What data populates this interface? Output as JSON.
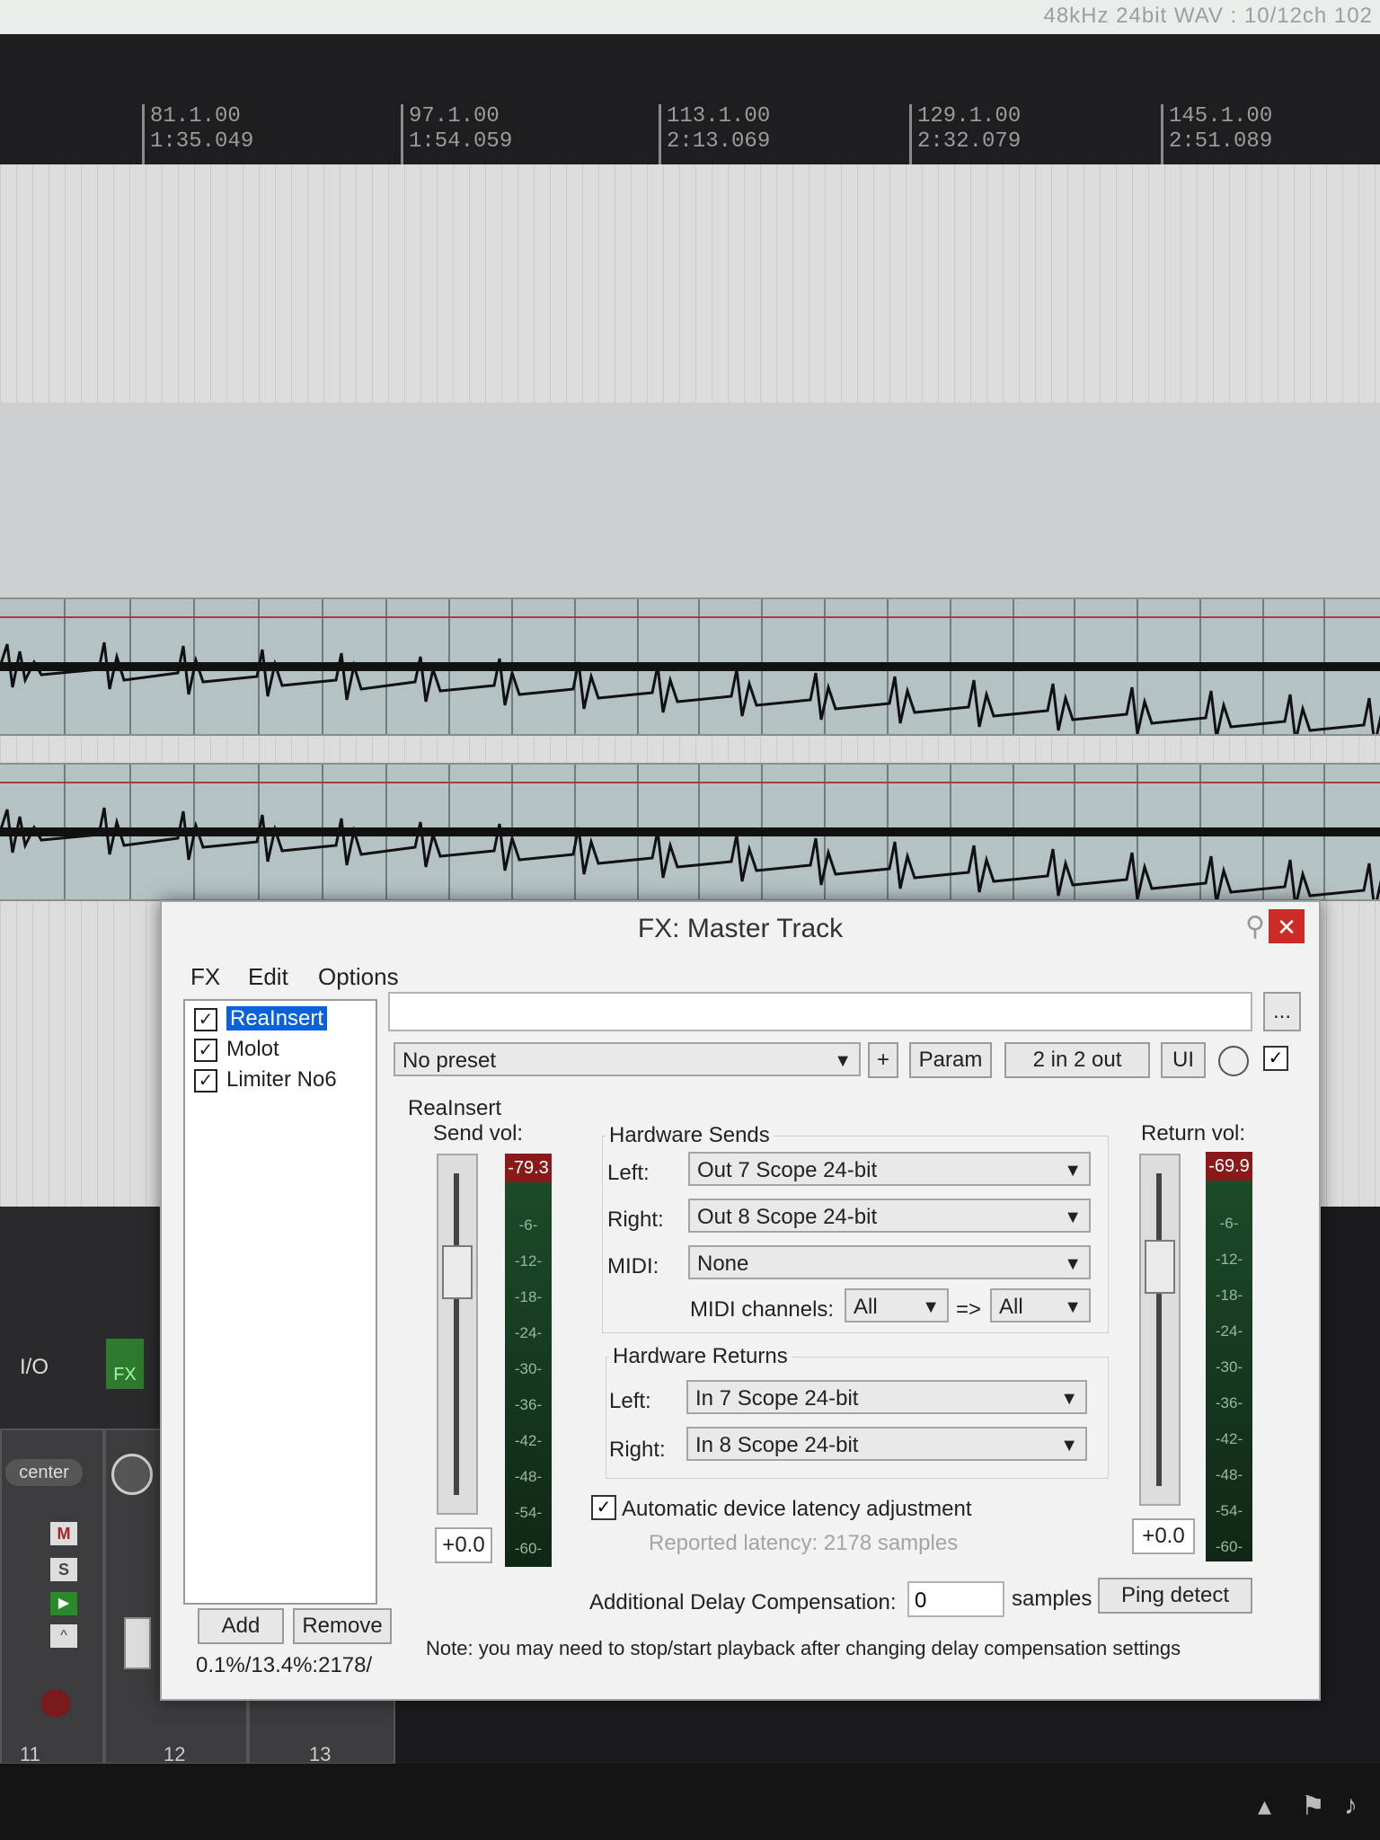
{
  "top_status": "48kHz 24bit WAV : 10/12ch 102",
  "ruler": {
    "ticks": [
      {
        "bar": "81.1.00",
        "time": "1:35.049"
      },
      {
        "bar": "97.1.00",
        "time": "1:54.059"
      },
      {
        "bar": "113.1.00",
        "time": "2:13.069"
      },
      {
        "bar": "129.1.00",
        "time": "2:32.079"
      },
      {
        "bar": "145.1.00",
        "time": "2:51.089"
      }
    ]
  },
  "mixer": {
    "channels": [
      "11",
      "12",
      "13"
    ],
    "io_label": "I/O",
    "fx_label": "FX",
    "pan_label": "center",
    "m_label": "M",
    "s_label": "S"
  },
  "fx_window": {
    "title": "FX: Master Track",
    "menu": [
      "FX",
      "Edit",
      "Options"
    ],
    "fx_chain": [
      {
        "name": "ReaInsert",
        "enabled": true,
        "selected": true
      },
      {
        "name": "Molot",
        "enabled": true,
        "selected": false
      },
      {
        "name": "Limiter No6",
        "enabled": true,
        "selected": false
      }
    ],
    "add_label": "Add",
    "remove_label": "Remove",
    "cpu_stats": "0.1%/13.4%:2178/",
    "preset": "No preset",
    "plus_label": "+",
    "param_label": "Param",
    "io_label": "2 in 2 out",
    "ui_label": "UI",
    "more_label": "...",
    "plugin": {
      "name": "ReaInsert",
      "send_vol_label": "Send vol:",
      "send_peak": "-79.3",
      "send_value": "+0.0",
      "return_vol_label": "Return vol:",
      "return_peak": "-69.9",
      "return_value": "+0.0",
      "meter_marks": [
        "-6-",
        "-12-",
        "-18-",
        "-24-",
        "-30-",
        "-36-",
        "-42-",
        "-48-",
        "-54-",
        "-60-"
      ],
      "hardware_sends_label": "Hardware Sends",
      "send_left_label": "Left:",
      "send_left": "Out 7 Scope 24-bit",
      "send_right_label": "Right:",
      "send_right": "Out 8 Scope 24-bit",
      "midi_label": "MIDI:",
      "midi": "None",
      "midi_channels_label": "MIDI channels:",
      "midi_channel_in": "All",
      "midi_arrow": "=>",
      "midi_channel_out": "All",
      "hardware_returns_label": "Hardware Returns",
      "return_left_label": "Left:",
      "return_left": "In 7 Scope 24-bit",
      "return_right_label": "Right:",
      "return_right": "In 8 Scope 24-bit",
      "auto_latency_label": "Automatic device latency adjustment",
      "auto_latency_checked": true,
      "reported_latency": "Reported latency: 2178 samples",
      "delay_comp_label": "Additional Delay Compensation:",
      "delay_comp_value": "0",
      "samples_label": "samples",
      "ping_detect_label": "Ping detect",
      "note": "Note: you may need to stop/start playback after changing delay compensation settings"
    }
  }
}
